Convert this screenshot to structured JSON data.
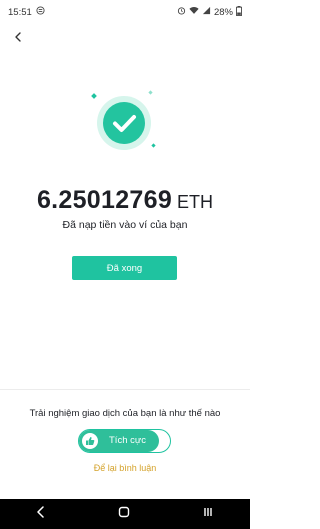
{
  "status_bar": {
    "time": "15:51",
    "battery": "28%",
    "icons": [
      "notification-icon",
      "alarm-icon",
      "wifi-icon",
      "signal-icon",
      "battery-icon"
    ]
  },
  "header": {
    "back_icon": "chevron-left-icon"
  },
  "result": {
    "amount": "6.25012769",
    "unit": "ETH",
    "message": "Đã nạp tiền vào ví của bạn",
    "done_label": "Đã xong",
    "success_icon": "check-circle-icon"
  },
  "feedback": {
    "question": "Trải nghiệm giao dịch của bạn là như thế nào",
    "positive_label": "Tích cực",
    "comment_label": "Để lại bình luận"
  },
  "nav": {
    "icons": [
      "back-nav-icon",
      "home-nav-icon",
      "recents-nav-icon"
    ]
  },
  "colors": {
    "accent": "#1fc3a0",
    "link": "#d4a22b",
    "text": "#1e2026"
  }
}
